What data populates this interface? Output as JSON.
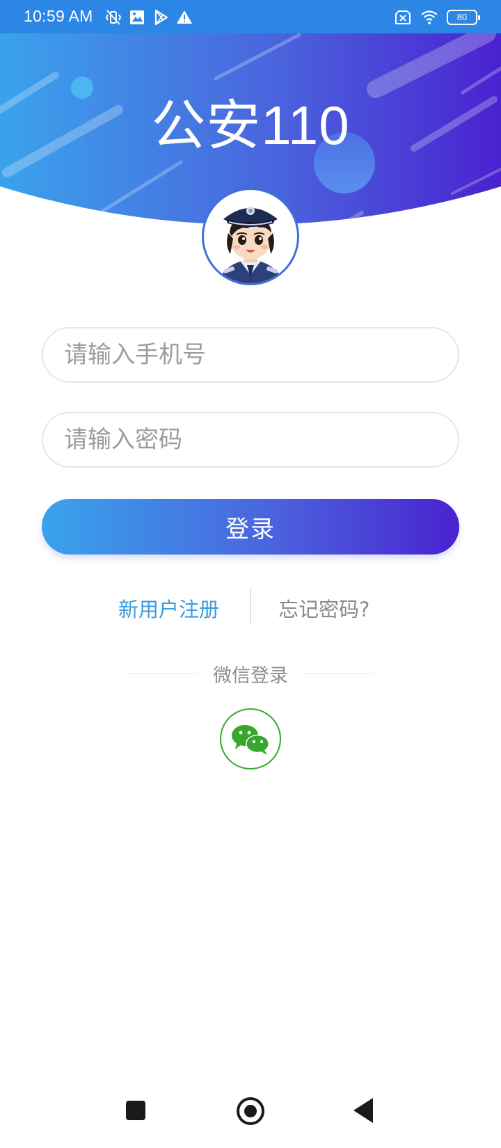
{
  "status_bar": {
    "time": "10:59 AM",
    "battery_level": "80",
    "icons_left": [
      "vibrate-off-icon",
      "image-icon",
      "play-store-icon",
      "warning-icon"
    ],
    "icons_right": [
      "sim-off-icon",
      "wifi-icon",
      "battery-icon"
    ]
  },
  "header": {
    "title": "公安110",
    "gradient_start": "#3aa3ec",
    "gradient_end": "#4a22d0"
  },
  "avatar": {
    "icon": "police-officer-avatar"
  },
  "login_form": {
    "phone_placeholder": "请输入手机号",
    "phone_value": "",
    "password_placeholder": "请输入密码",
    "password_value": "",
    "login_button_label": "登录"
  },
  "links": {
    "register_label": "新用户注册",
    "forgot_label": "忘记密码?",
    "register_color": "#3a9de0"
  },
  "wechat": {
    "label": "微信登录",
    "icon": "wechat-icon",
    "color": "#37a82c"
  },
  "navigation": {
    "recent_icon": "square-icon",
    "home_icon": "home-icon",
    "back_icon": "back-icon"
  }
}
